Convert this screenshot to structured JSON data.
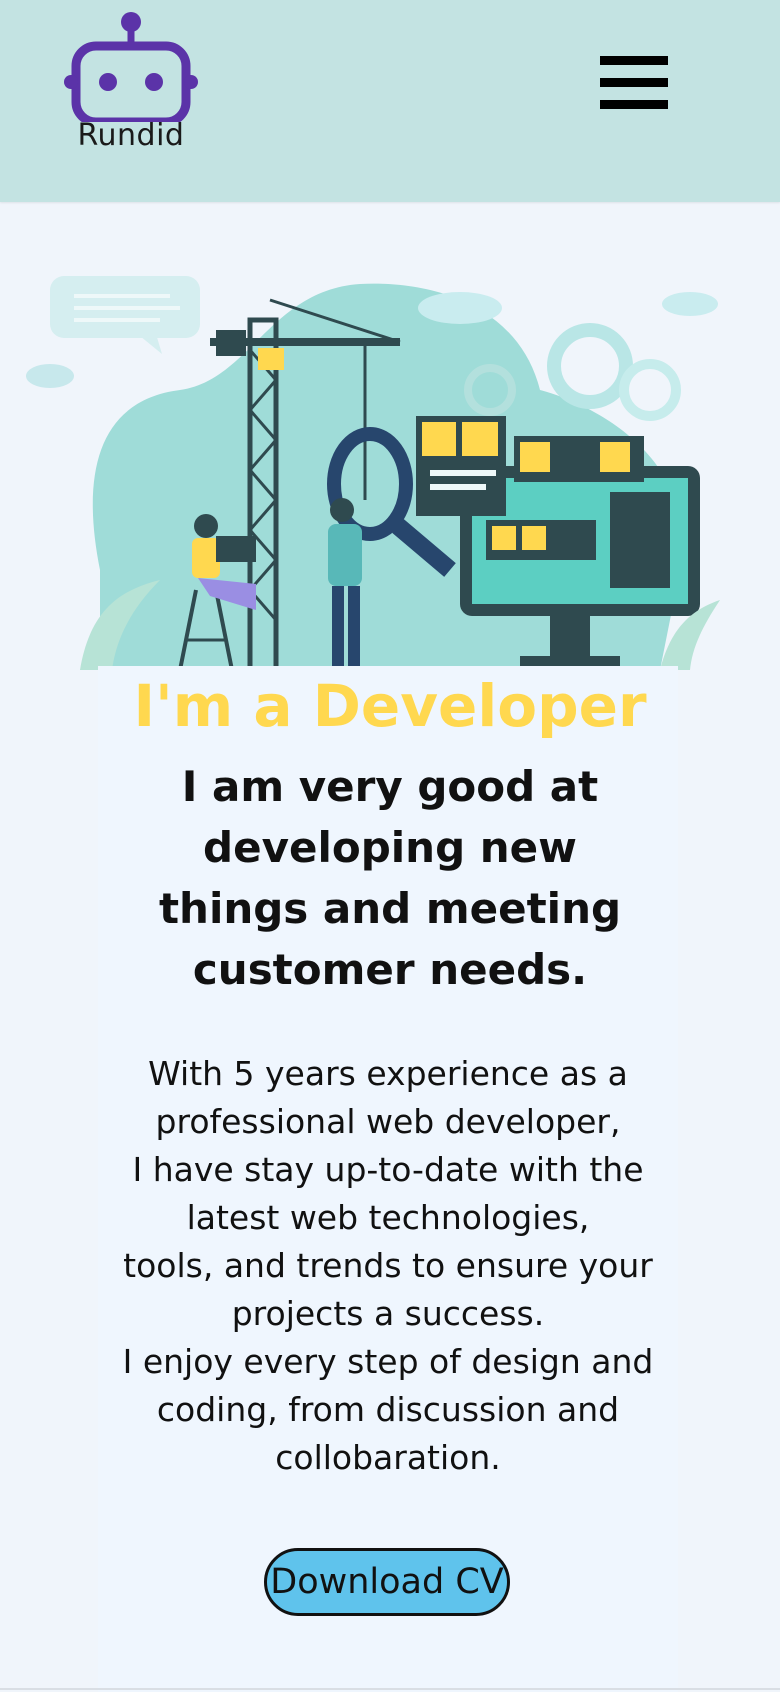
{
  "header": {
    "logo_text": "Rundid",
    "menu_icon": "hamburger-menu-icon"
  },
  "hero": {
    "illustration": "developer-construction-illustration",
    "title": "I'm a Developer",
    "subtitle": "I am very good at developing new things and meeting customer needs.",
    "bio": [
      "With 5 years experience as a professional web developer,",
      "I have stay up-to-date with the latest web technologies,",
      "tools, and trends to ensure your projects a success.",
      "I enjoy every step of design and coding, from discussion and collobaration."
    ],
    "cta_label": "Download CV"
  },
  "colors": {
    "header_bg": "#c3e3e2",
    "page_bg": "#f0f5fb",
    "title": "#ffd84f",
    "button_bg": "#5fc3ec",
    "logo_purple": "#5b33a8",
    "illustration_teal": "#9fdcd8"
  }
}
